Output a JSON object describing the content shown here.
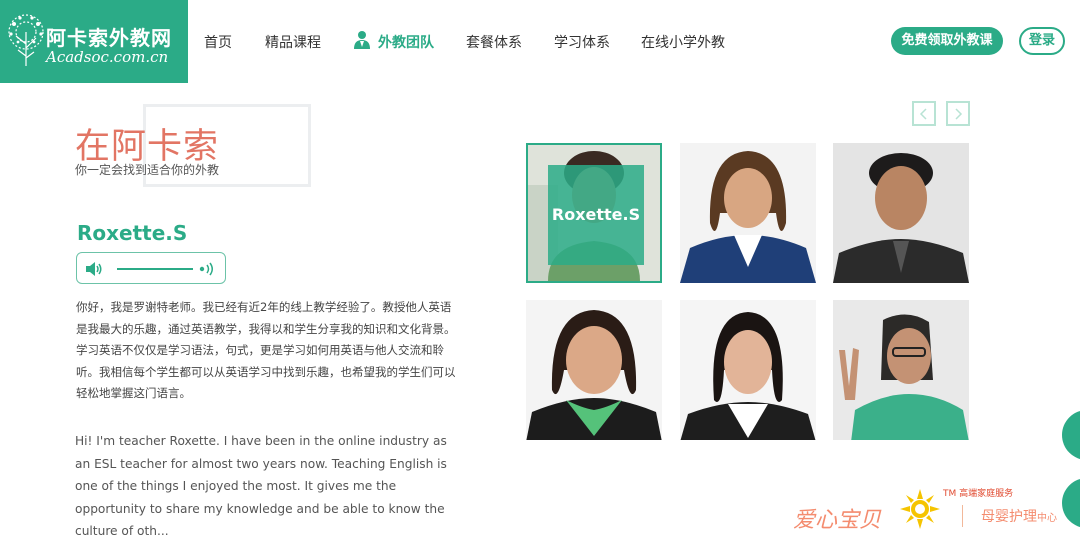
{
  "brand": {
    "name_cn": "阿卡索外教网",
    "domain": "Acadsoc.com.cn",
    "accent": "#2bab87"
  },
  "nav": {
    "items": [
      {
        "label": "首页",
        "active": false
      },
      {
        "label": "精品课程",
        "active": false
      },
      {
        "label": "外教团队",
        "active": true,
        "icon": "teacher-icon"
      },
      {
        "label": "套餐体系",
        "active": false
      },
      {
        "label": "学习体系",
        "active": false
      },
      {
        "label": "在线小学外教",
        "active": false
      }
    ],
    "cta_label": "免费领取外教课",
    "login_label": "登录"
  },
  "hero": {
    "title": "在阿卡索",
    "subtitle": "你一定会找到适合你的外教"
  },
  "teacher": {
    "name": "Roxette.S",
    "bio_cn": "你好，我是罗谢特老师。我已经有近2年的线上教学经验了。教授他人英语是我最大的乐趣，通过英语教学，我得以和学生分享我的知识和文化背景。学习英语不仅仅是学习语法，句式，更是学习如何用英语与他人交流和聆听。我相信每个学生都可以从英语学习中找到乐趣，也希望我的学生们可以轻松地掌握这门语言。",
    "bio_en": "Hi! I'm teacher Roxette. I have been in the online industry as an ESL teacher for almost two years now. Teaching English is one of the things I enjoyed the most. It gives me the opportunity to share my knowledge and be able to know the culture of oth..."
  },
  "gallery": {
    "selected_label": "Roxette.S",
    "prev_icon": "chevron-left-icon",
    "next_icon": "chevron-right-icon"
  },
  "watermark": {
    "left": "爱心宝贝",
    "tm": "TM 高端家庭服务",
    "right_main": "母婴护理",
    "right_small": "中心"
  }
}
